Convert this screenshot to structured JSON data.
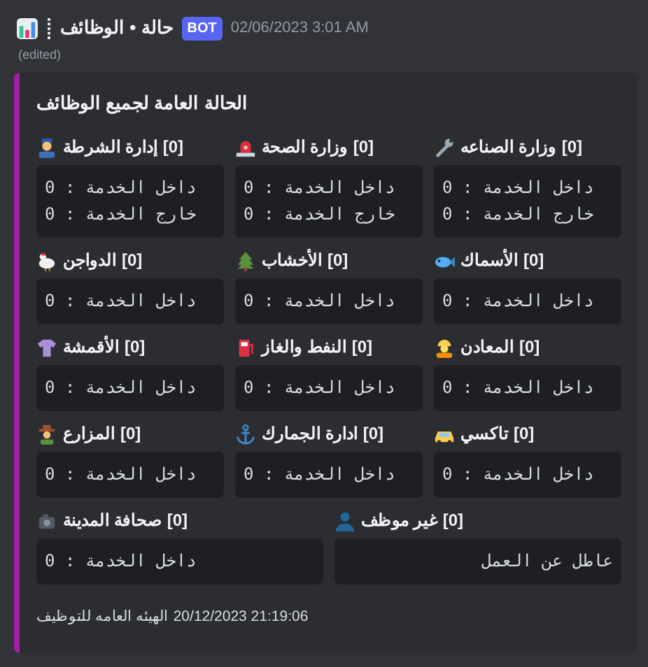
{
  "message": {
    "author": "حالة • الوظائف",
    "badge": "BOT",
    "timestamp": "02/06/2023 3:01 AM",
    "edited": "(edited)"
  },
  "embed": {
    "color": "#a51ea8",
    "title": "الحالة العامة لجميع الوظائف",
    "fields": [
      {
        "name": "وزارة الصناعه",
        "count": "[0]",
        "lines": [
          "داخل الخدمة : 0",
          "خارج الخدمة : 0"
        ]
      },
      {
        "name": "وزارة الصحة",
        "count": "[0]",
        "lines": [
          "داخل الخدمة : 0",
          "خارج الخدمة : 0"
        ]
      },
      {
        "name": "إدارة الشرطة",
        "count": "[0]",
        "lines": [
          "داخل الخدمة : 0",
          "خارج الخدمة : 0"
        ]
      },
      {
        "name": "الأسماك",
        "count": "[0]",
        "lines": [
          "داخل الخدمة : 0"
        ]
      },
      {
        "name": "الأخشاب",
        "count": "[0]",
        "lines": [
          "داخل الخدمة : 0"
        ]
      },
      {
        "name": "الدواجن",
        "count": "[0]",
        "lines": [
          "داخل الخدمة : 0"
        ]
      },
      {
        "name": "المعادن",
        "count": "[0]",
        "lines": [
          "داخل الخدمة : 0"
        ]
      },
      {
        "name": "النفط والغاز",
        "count": "[0]",
        "lines": [
          "داخل الخدمة : 0"
        ]
      },
      {
        "name": "الأقمشة",
        "count": "[0]",
        "lines": [
          "داخل الخدمة : 0"
        ]
      },
      {
        "name": "تاكسي",
        "count": "[0]",
        "lines": [
          "داخل الخدمة : 0"
        ]
      },
      {
        "name": "ادارة الجمارك",
        "count": "[0]",
        "lines": [
          "داخل الخدمة : 0"
        ]
      },
      {
        "name": "المزارع",
        "count": "[0]",
        "lines": [
          "داخل الخدمة : 0"
        ]
      },
      {
        "name": "غير موظف",
        "count": "[0]",
        "lines": [
          "عاطل عن العمل"
        ]
      },
      {
        "name": "صحافة المدينة",
        "count": "[0]",
        "lines": [
          "داخل الخدمة : 0"
        ]
      }
    ],
    "footer": {
      "text": "الهيئه العامه للتوظيف",
      "timestamp": "20/12/2023 21:19:06"
    }
  }
}
